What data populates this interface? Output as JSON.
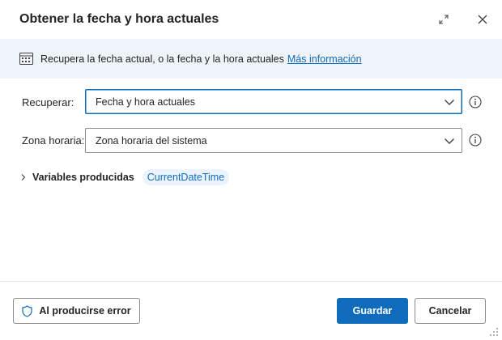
{
  "dialog": {
    "title": "Obtener la fecha y hora actuales"
  },
  "info": {
    "text": "Recupera la fecha actual, o la fecha y la hora actuales",
    "link": "Más información",
    "icon": "calendar-icon"
  },
  "fields": {
    "retrieve": {
      "label": "Recuperar:",
      "value": "Fecha y hora actuales"
    },
    "timezone": {
      "label": "Zona horaria:",
      "value": "Zona horaria del sistema"
    }
  },
  "variables": {
    "label": "Variables producidas",
    "items": [
      "CurrentDateTime"
    ]
  },
  "footer": {
    "on_error_label": "Al producirse error",
    "save_label": "Guardar",
    "cancel_label": "Cancelar"
  },
  "colors": {
    "accent": "#0f6cbd",
    "info_bg": "#eff4fb",
    "chip_bg": "#ebf3fc"
  }
}
